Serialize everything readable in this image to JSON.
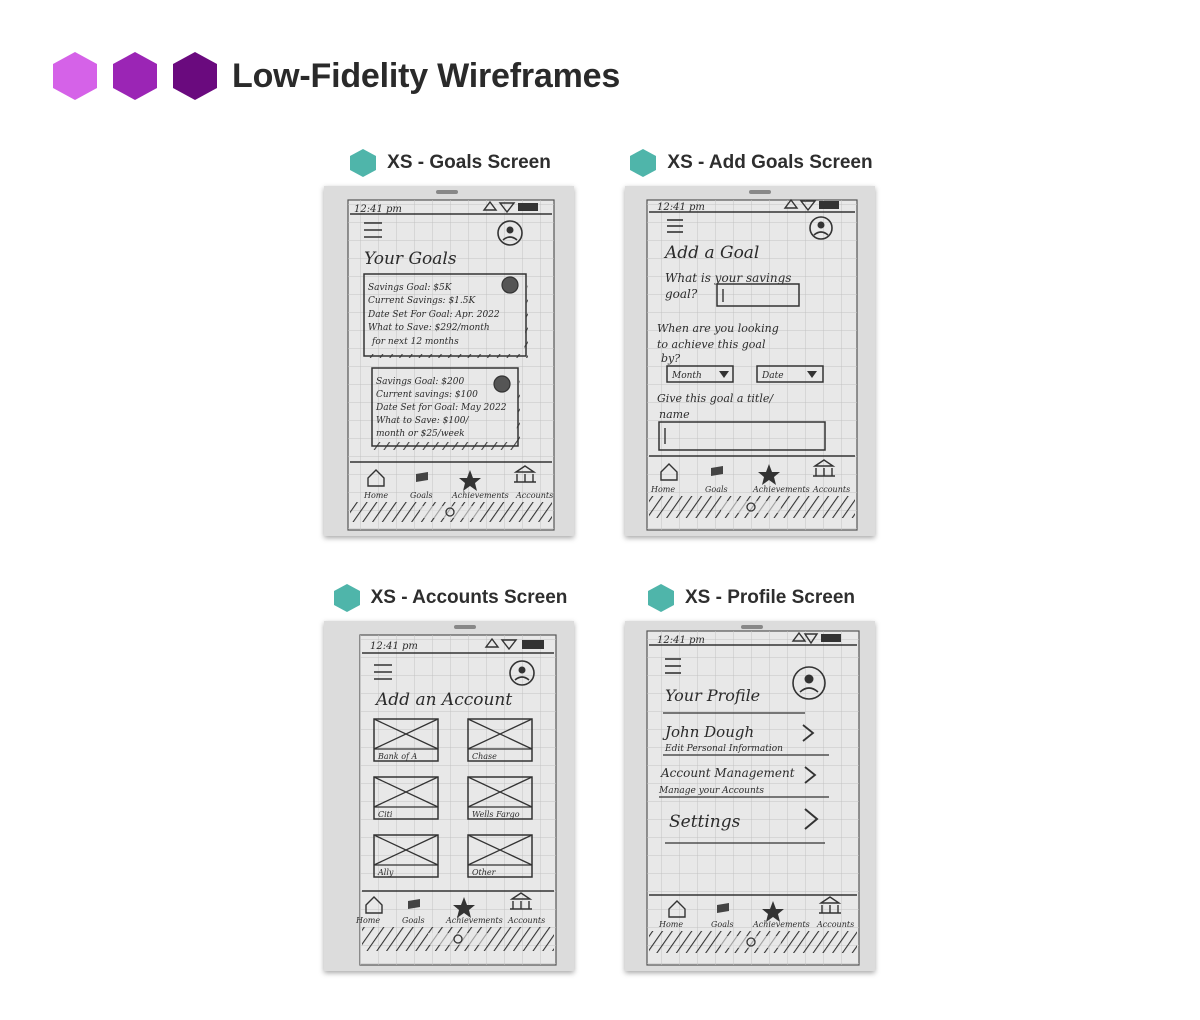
{
  "page": {
    "title": "Low-Fidelity Wireframes",
    "hex_colors": [
      "#d562e8",
      "#9b25b5",
      "#6a0a7e"
    ],
    "label_hex_color": "#4fb5aa"
  },
  "cards": [
    {
      "label": "XS - Goals Screen",
      "time": "12:41 pm",
      "screen_title": "Your Goals",
      "goal1": [
        "Savings Goal: $5K",
        "Current Savings: $1.5K",
        "Date Set For Goal: Apr. 2022",
        "What to Save: $292/month",
        "for next 12 months"
      ],
      "goal2": [
        "Savings Goal: $200",
        "Current savings: $100",
        "Date Set for Goal: May 2022",
        "What to Save: $100/",
        "month or $25/week"
      ],
      "nav": [
        "Home",
        "Goals",
        "Achievements",
        "Accounts"
      ]
    },
    {
      "label": "XS - Add Goals Screen",
      "time": "12:41 pm",
      "screen_title": "Add a Goal",
      "q1": [
        "What is your savings",
        "goal?"
      ],
      "q2": [
        "When are you looking",
        "to achieve this goal",
        "by?"
      ],
      "month": "Month",
      "date": "Date",
      "q3": [
        "Give this goal a title/",
        "name"
      ],
      "nav": [
        "Home",
        "Goals",
        "Achievements",
        "Accounts"
      ]
    },
    {
      "label": "XS - Accounts Screen",
      "time": "12:41 pm",
      "screen_title": "Add an Account",
      "accounts": [
        "Bank of A",
        "Chase",
        "Citi",
        "Wells Fargo",
        "Ally",
        "Other"
      ],
      "nav": [
        "Home",
        "Goals",
        "Achievements",
        "Accounts"
      ]
    },
    {
      "label": "XS - Profile Screen",
      "time": "12:41 pm",
      "screen_title": "Your Profile",
      "rows": [
        {
          "main": "John Dough",
          "sub": "Edit Personal Information"
        },
        {
          "main": "Account Management",
          "sub": "Manage your Accounts"
        },
        {
          "main": "Settings",
          "sub": ""
        }
      ],
      "nav": [
        "Home",
        "Goals",
        "Achievements",
        "Accounts"
      ]
    }
  ]
}
